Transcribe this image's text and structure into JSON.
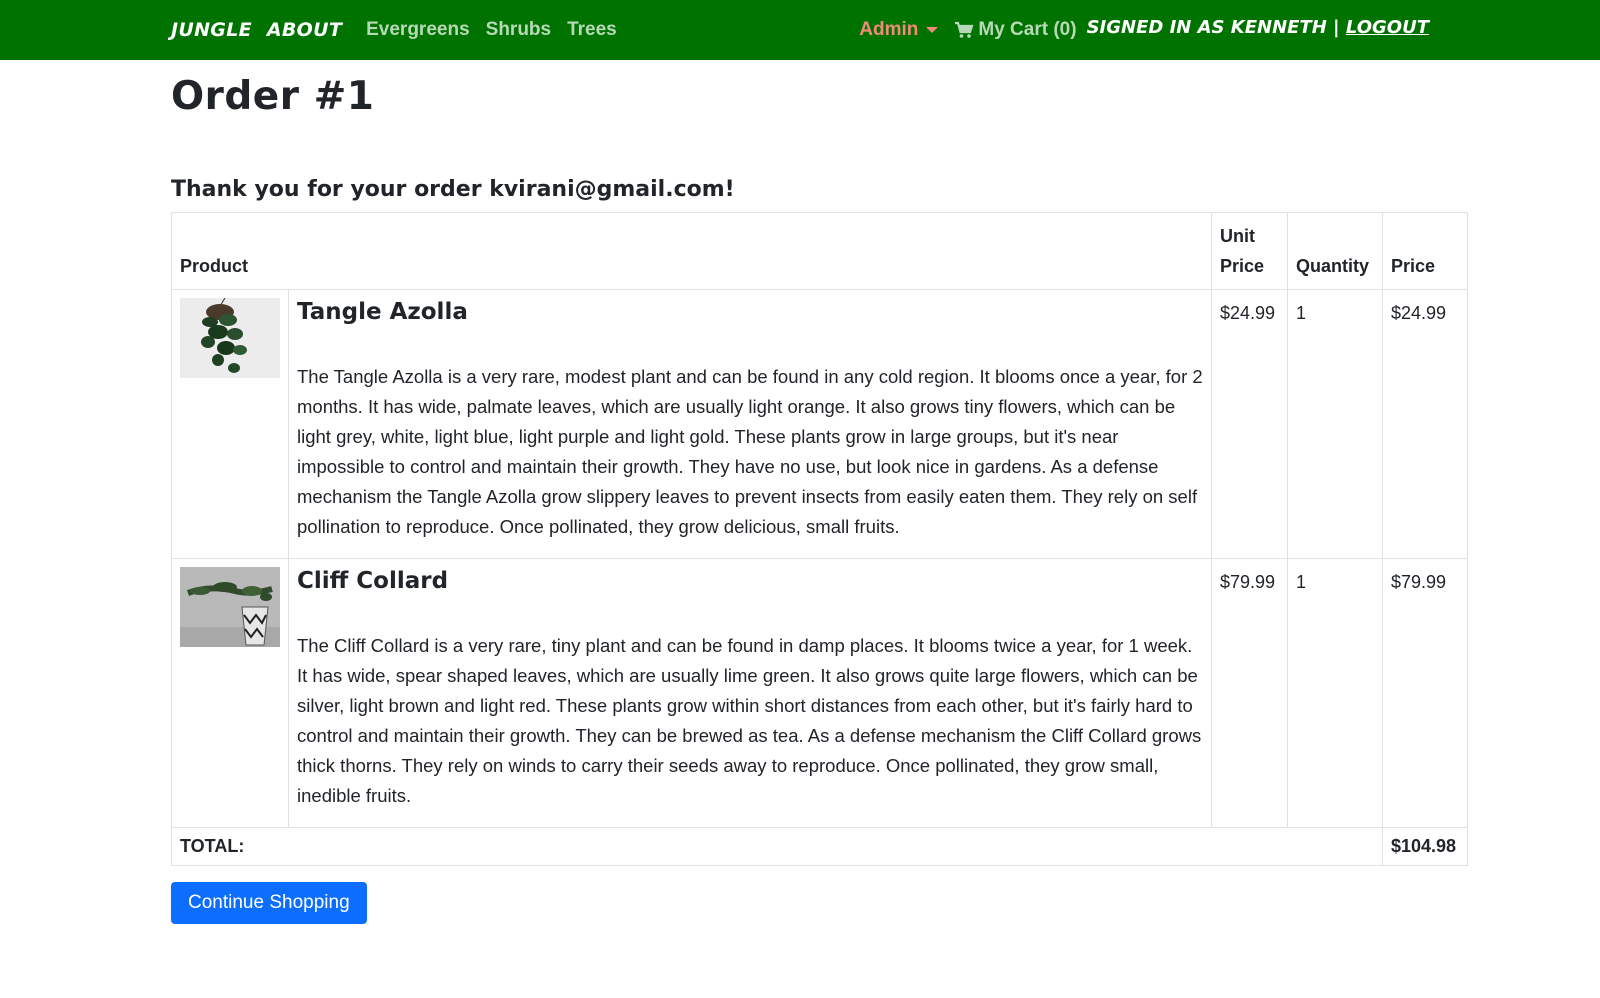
{
  "nav": {
    "brand": "Jungle",
    "about": "About",
    "links": [
      "Evergreens",
      "Shrubs",
      "Trees"
    ],
    "admin": "Admin",
    "cart": "My Cart (0)",
    "signed_in": "Signed in as Kenneth |",
    "logout": "Logout"
  },
  "page": {
    "title": "Order #1",
    "thanks": "Thank you for your order kvirani@gmail.com!"
  },
  "table": {
    "headers": {
      "product": "Product",
      "unit_price": "Unit Price",
      "quantity": "Quantity",
      "price": "Price"
    },
    "rows": [
      {
        "name": "Tangle Azolla",
        "description": "The Tangle Azolla is a very rare, modest plant and can be found in any cold region. It blooms once a year, for 2 months. It has wide, palmate leaves, which are usually light orange. It also grows tiny flowers, which can be light grey, white, light blue, light purple and light gold. These plants grow in large groups, but it's near impossible to control and maintain their growth. They have no use, but look nice in gardens. As a defense mechanism the Tangle Azolla grow slippery leaves to prevent insects from easily eaten them. They rely on self pollination to reproduce. Once pollinated, they grow delicious, small fruits.",
        "unit_price": "$24.99",
        "quantity": "1",
        "price": "$24.99"
      },
      {
        "name": "Cliff Collard",
        "description": "The Cliff Collard is a very rare, tiny plant and can be found in damp places. It blooms twice a year, for 1 week. It has wide, spear shaped leaves, which are usually lime green. It also grows quite large flowers, which can be silver, light brown and light red. These plants grow within short distances from each other, but it's fairly hard to control and maintain their growth. They can be brewed as tea. As a defense mechanism the Cliff Collard grows thick thorns. They rely on winds to carry their seeds away to reproduce. Once pollinated, they grow small, inedible fruits.",
        "unit_price": "$79.99",
        "quantity": "1",
        "price": "$79.99"
      }
    ],
    "total_label": "TOTAL:",
    "total_value": "$104.98"
  },
  "actions": {
    "continue": "Continue Shopping"
  },
  "colors": {
    "navbar": "#007200",
    "admin": "#f08b7a",
    "primary_button": "#0d6efd"
  }
}
